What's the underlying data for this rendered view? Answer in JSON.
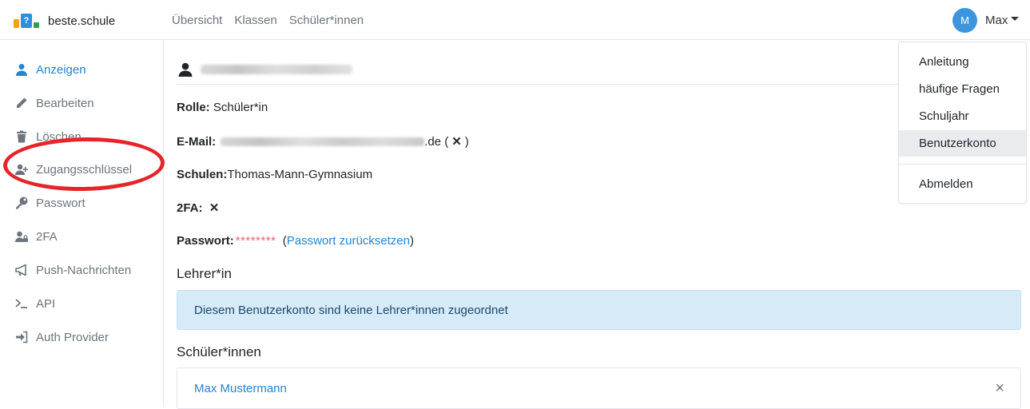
{
  "brand": {
    "name": "beste.schule",
    "logo_letter": "?"
  },
  "nav": {
    "links": [
      "Übersicht",
      "Klassen",
      "Schüler*innen"
    ]
  },
  "user": {
    "initial": "M",
    "name": "Max"
  },
  "sidebar": {
    "items": [
      {
        "label": "Anzeigen",
        "icon": "user-icon",
        "active": true
      },
      {
        "label": "Bearbeiten",
        "icon": "pencil-icon",
        "active": false
      },
      {
        "label": "Löschen",
        "icon": "trash-icon",
        "active": false
      },
      {
        "label": "Zugangsschlüssel",
        "icon": "user-plus-icon",
        "active": false
      },
      {
        "label": "Passwort",
        "icon": "key-icon",
        "active": false
      },
      {
        "label": "2FA",
        "icon": "user-lock-icon",
        "active": false
      },
      {
        "label": "Push-Nachrichten",
        "icon": "megaphone-icon",
        "active": false
      },
      {
        "label": "API",
        "icon": "terminal-icon",
        "active": false
      },
      {
        "label": "Auth Provider",
        "icon": "sign-in-icon",
        "active": false
      }
    ]
  },
  "profile": {
    "role_label": "Rolle:",
    "role_value": "Schüler*in",
    "email_label": "E-Mail:",
    "email_suffix": ".de (",
    "email_x": "✕",
    "email_close": ")",
    "schools_label": "Schulen:",
    "schools_value": "Thomas-Mann-Gymnasium",
    "twofa_label": "2FA:",
    "twofa_value": "✕",
    "password_label": "Passwort:",
    "password_value": "********",
    "password_link_open": "(",
    "password_link": "Passwort zurücksetzen",
    "password_link_close": ")"
  },
  "teachers": {
    "title": "Lehrer*in",
    "empty_message": "Diesem Benutzerkonto sind keine Lehrer*innen zugeordnet"
  },
  "students": {
    "title": "Schüler*innen",
    "items": [
      {
        "name": "Max Mustermann",
        "remove": "×"
      }
    ]
  },
  "dropdown": {
    "items": [
      "Anleitung",
      "häufige Fragen",
      "Schuljahr",
      "Benutzerkonto",
      "Abmelden"
    ],
    "hovered": "Benutzerkonto"
  },
  "colors": {
    "accent": "#2385d6",
    "annotation": "#e5252a",
    "alert_bg": "#d6eaf8"
  }
}
